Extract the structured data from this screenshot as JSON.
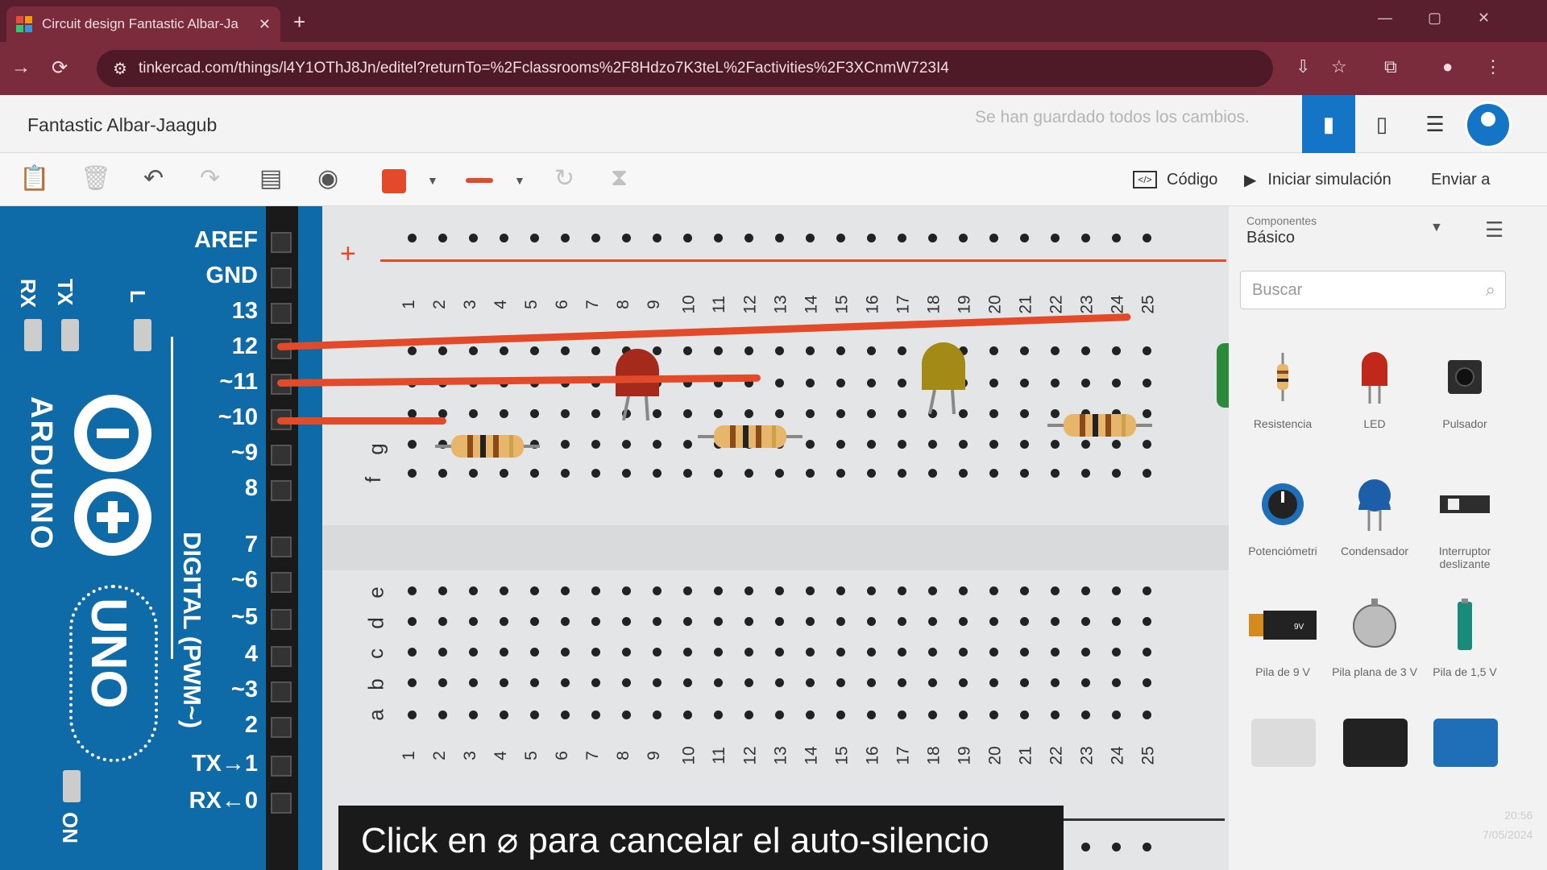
{
  "browser": {
    "tab_title": "Circuit design Fantastic Albar-Ja",
    "tab_close": "✕",
    "new_tab": "+",
    "url": "tinkercad.com/things/l4Y1OThJ8Jn/editel?returnTo=%2Fclassrooms%2F8Hdzo7K3teL%2Factivities%2F3XCnmW723I4",
    "win_minimize": "—",
    "win_restore": "▢",
    "win_close": "✕"
  },
  "header": {
    "project_name": "Fantastic Albar-Jaagub",
    "save_status": "Se han guardado todos los cambios."
  },
  "toolbar": {
    "code_label": "Código",
    "simulate_label": "Iniciar simulación",
    "send_label": "Enviar a",
    "wire_color": "#e24a2a"
  },
  "arduino": {
    "pins": [
      "AREF",
      "GND",
      "13",
      "12",
      "~11",
      "~10",
      "~9",
      "8",
      "7",
      "~6",
      "~5",
      "4",
      "~3",
      "2",
      "TX→1",
      "RX←0"
    ],
    "rx_label": "RX",
    "tx_label": "TX",
    "l_label": "L",
    "brand": "ARDUINO",
    "model": "UNO",
    "digital_label": "DIGITAL (PWM~)",
    "on_label": "ON"
  },
  "breadboard": {
    "plus_label": "+",
    "col_numbers": [
      "1",
      "2",
      "3",
      "4",
      "5",
      "6",
      "7",
      "8",
      "9",
      "10",
      "11",
      "12",
      "13",
      "14",
      "15",
      "16",
      "17",
      "18",
      "19",
      "20",
      "21",
      "22",
      "23",
      "24",
      "25"
    ],
    "upper_rows": [
      "g",
      "f"
    ],
    "lower_rows": [
      "e",
      "d",
      "c",
      "b",
      "a"
    ]
  },
  "panel": {
    "category_label": "Componentes",
    "category_value": "Básico",
    "search_placeholder": "Buscar",
    "components": [
      {
        "label": "Resistencia",
        "icon": "resistor-icon"
      },
      {
        "label": "LED",
        "icon": "led-icon"
      },
      {
        "label": "Pulsador",
        "icon": "pushbutton-icon"
      },
      {
        "label": "Potencióme­tri",
        "icon": "potentiometer-icon"
      },
      {
        "label": "Condensador",
        "icon": "capacitor-icon"
      },
      {
        "label": "Interruptor deslizante",
        "icon": "slide-switch-icon"
      },
      {
        "label": "Pila de 9 V",
        "icon": "battery-9v-icon"
      },
      {
        "label": "Pila plana de 3 V",
        "icon": "coin-cell-icon"
      },
      {
        "label": "Pila de 1,5 V",
        "icon": "battery-aa-icon"
      }
    ]
  },
  "notification": {
    "text": "Click en  ⌀ para cancelar el auto-silencio"
  },
  "clock": {
    "time": "20:56",
    "date": "7/05/2024"
  }
}
